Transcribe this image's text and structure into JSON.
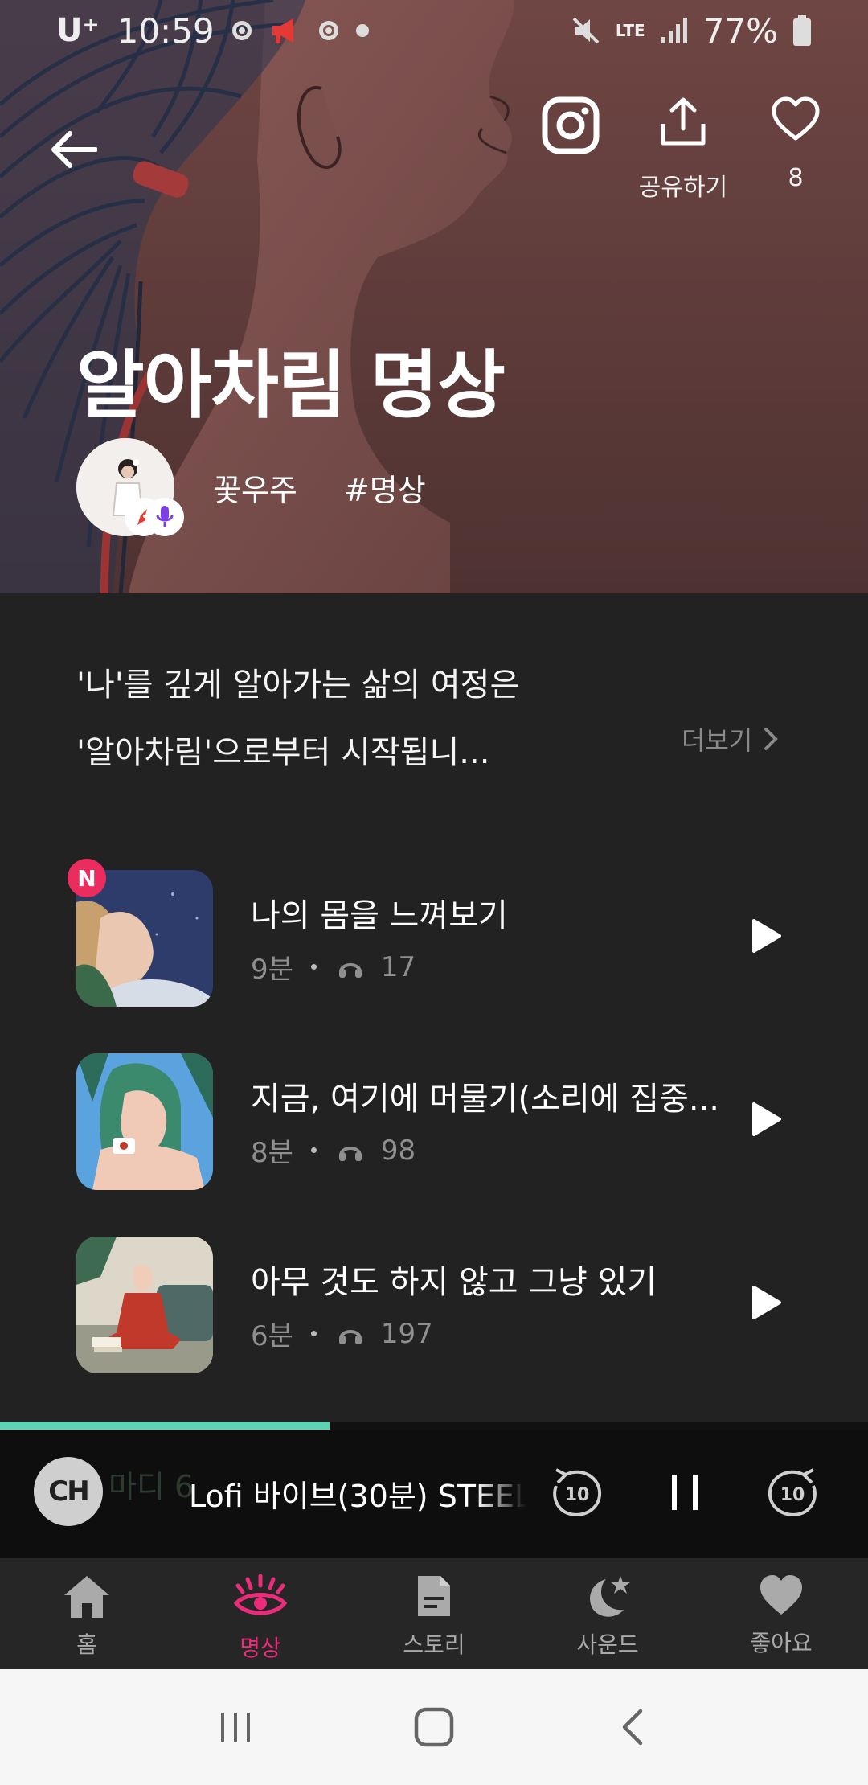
{
  "status_bar": {
    "carrier": "U⁺",
    "time": "10:59",
    "network": "LTE",
    "battery": "77%"
  },
  "header": {
    "share_label": "공유하기",
    "like_count": "8"
  },
  "program": {
    "title": "알아차림 명상",
    "author": "꽃우주",
    "tag": "#명상",
    "description_line1": "'나'를 깊게 알아가는 삶의 여정은",
    "description_line2": "'알아차림'으로부터 시작됩니...",
    "more_label": "더보기"
  },
  "tracks": [
    {
      "title": "나의 몸을 느껴보기",
      "duration": "9분",
      "plays": "17",
      "is_new": true,
      "new_label": "N"
    },
    {
      "title": "지금, 여기에 머물기(소리에 집중...",
      "duration": "8분",
      "plays": "98",
      "is_new": false
    },
    {
      "title": "아무 것도 하지 않고 그냥 있기",
      "duration": "6분",
      "plays": "197",
      "is_new": false
    }
  ],
  "player": {
    "logo_text": "CH",
    "background_text": "마디 6",
    "now_playing": "Lofi 바이브(30분) STEEL",
    "progress": 0.38,
    "rewind_label": "10",
    "forward_label": "10"
  },
  "bottom_nav": [
    {
      "label": "홈",
      "icon": "home-icon",
      "active": false
    },
    {
      "label": "명상",
      "icon": "eye-icon",
      "active": true
    },
    {
      "label": "스토리",
      "icon": "document-icon",
      "active": false
    },
    {
      "label": "사운드",
      "icon": "moon-star-icon",
      "active": false
    },
    {
      "label": "좋아요",
      "icon": "heart-icon",
      "active": false
    }
  ],
  "colors": {
    "accent": "#ea2c7a",
    "progress": "#5fd1b4",
    "background": "#222222",
    "new_badge": "#ea2c5e"
  }
}
